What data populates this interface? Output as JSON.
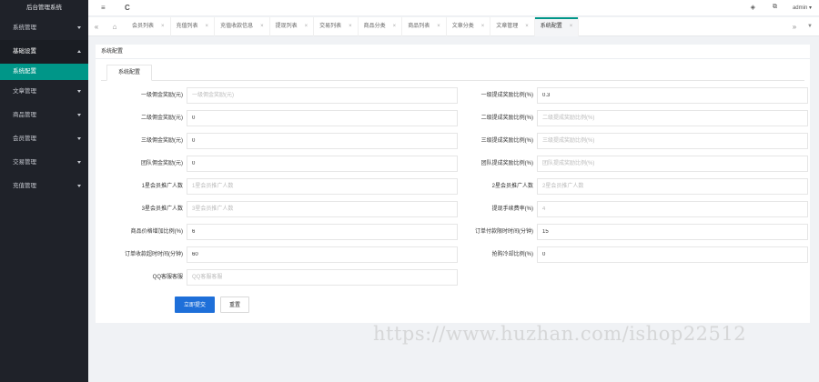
{
  "sidebar": {
    "logo": "后台管理系统",
    "items": [
      {
        "label": "系统管理",
        "expanded": false
      },
      {
        "label": "基础设置",
        "expanded": true,
        "children": [
          {
            "label": "系统配置",
            "active": true
          }
        ]
      },
      {
        "label": "文章管理",
        "expanded": false
      },
      {
        "label": "商品管理",
        "expanded": false
      },
      {
        "label": "会员管理",
        "expanded": false
      },
      {
        "label": "交易管理",
        "expanded": false
      },
      {
        "label": "充值管理",
        "expanded": false
      }
    ]
  },
  "header": {
    "menu_icon": "≡",
    "refresh_icon": "C",
    "user": "admin ▾"
  },
  "tabbar": {
    "nav_left": "«",
    "nav_right": "»",
    "dropdown": "▼",
    "close_glyph": "×",
    "tabs": [
      {
        "label": "会员列表",
        "active": false
      },
      {
        "label": "充值列表",
        "active": false
      },
      {
        "label": "充值收款信息",
        "active": false
      },
      {
        "label": "提现列表",
        "active": false
      },
      {
        "label": "交易列表",
        "active": false
      },
      {
        "label": "商品分类",
        "active": false
      },
      {
        "label": "商品列表",
        "active": false
      },
      {
        "label": "文章分类",
        "active": false
      },
      {
        "label": "文章管理",
        "active": false
      },
      {
        "label": "系统配置",
        "active": true
      }
    ]
  },
  "panel": {
    "title": "系统配置",
    "tab_label": "系统配置",
    "fields": [
      {
        "label": "一级佣金奖励(元)",
        "value": "",
        "placeholder": "一级佣金奖励(元)"
      },
      {
        "label": "一级提成奖励比例(%)",
        "value": "0.3",
        "placeholder": ""
      },
      {
        "label": "二级佣金奖励(元)",
        "value": "0",
        "placeholder": ""
      },
      {
        "label": "二级提成奖励比例(%)",
        "value": "",
        "placeholder": "二级提成奖励比例(%)"
      },
      {
        "label": "三级佣金奖励(元)",
        "value": "0",
        "placeholder": ""
      },
      {
        "label": "三级提成奖励比例(%)",
        "value": "",
        "placeholder": "三级提成奖励比例(%)"
      },
      {
        "label": "团队佣金奖励(元)",
        "value": "0",
        "placeholder": ""
      },
      {
        "label": "团队提成奖励比例(%)",
        "value": "",
        "placeholder": "团队提成奖励比例(%)"
      },
      {
        "label": "1星会员推广人数",
        "value": "",
        "placeholder": "1星会员推广人数"
      },
      {
        "label": "2星会员推广人数",
        "value": "",
        "placeholder": "2星会员推广人数"
      },
      {
        "label": "3星会员推广人数",
        "value": "",
        "placeholder": "3星会员推广人数"
      },
      {
        "label": "提现手续费率(%)",
        "value": "",
        "placeholder": "4"
      },
      {
        "label": "商品价格增加比例(%)",
        "value": "6",
        "placeholder": ""
      },
      {
        "label": "订单付款限时时间(分钟)",
        "value": "15",
        "placeholder": ""
      },
      {
        "label": "订单收款超时时间(分钟)",
        "value": "60",
        "placeholder": ""
      },
      {
        "label": "抢购冷却比例(%)",
        "value": "0",
        "placeholder": ""
      },
      {
        "label": "QQ客服客服",
        "value": "",
        "placeholder": "QQ客服客服"
      }
    ],
    "submit_label": "立即提交",
    "reset_label": "重置"
  },
  "watermark": "https://www.huzhan.com/ishop22512"
}
